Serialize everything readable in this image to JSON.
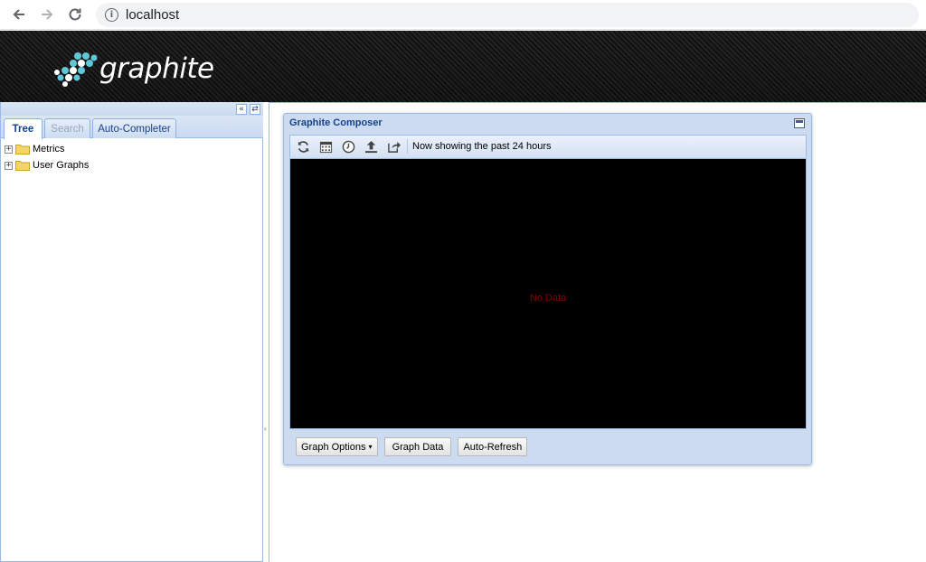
{
  "browser": {
    "url": "localhost"
  },
  "header": {
    "logo_text": "graphite"
  },
  "left_panel": {
    "tabs": [
      {
        "label": "Tree",
        "state": "active"
      },
      {
        "label": "Search",
        "state": "disabled"
      },
      {
        "label": "Auto-Completer",
        "state": "normal"
      }
    ],
    "tree": [
      {
        "label": "Metrics",
        "icon": "folder-icon"
      },
      {
        "label": "User Graphs",
        "icon": "folder-icon"
      }
    ]
  },
  "composer": {
    "title": "Graphite Composer",
    "toolbar": {
      "icons": [
        "refresh-icon",
        "calendar-icon",
        "clock-icon",
        "upload-icon",
        "share-icon"
      ],
      "status_text": "Now showing the past 24 hours"
    },
    "graph": {
      "message": "No Data",
      "background": "#000000",
      "message_color": "#8b0000"
    },
    "buttons": {
      "graph_options": "Graph Options",
      "graph_data": "Graph Data",
      "auto_refresh": "Auto-Refresh"
    }
  },
  "colors": {
    "accent_blue": "#15428b",
    "panel_border": "#99bbe8"
  }
}
